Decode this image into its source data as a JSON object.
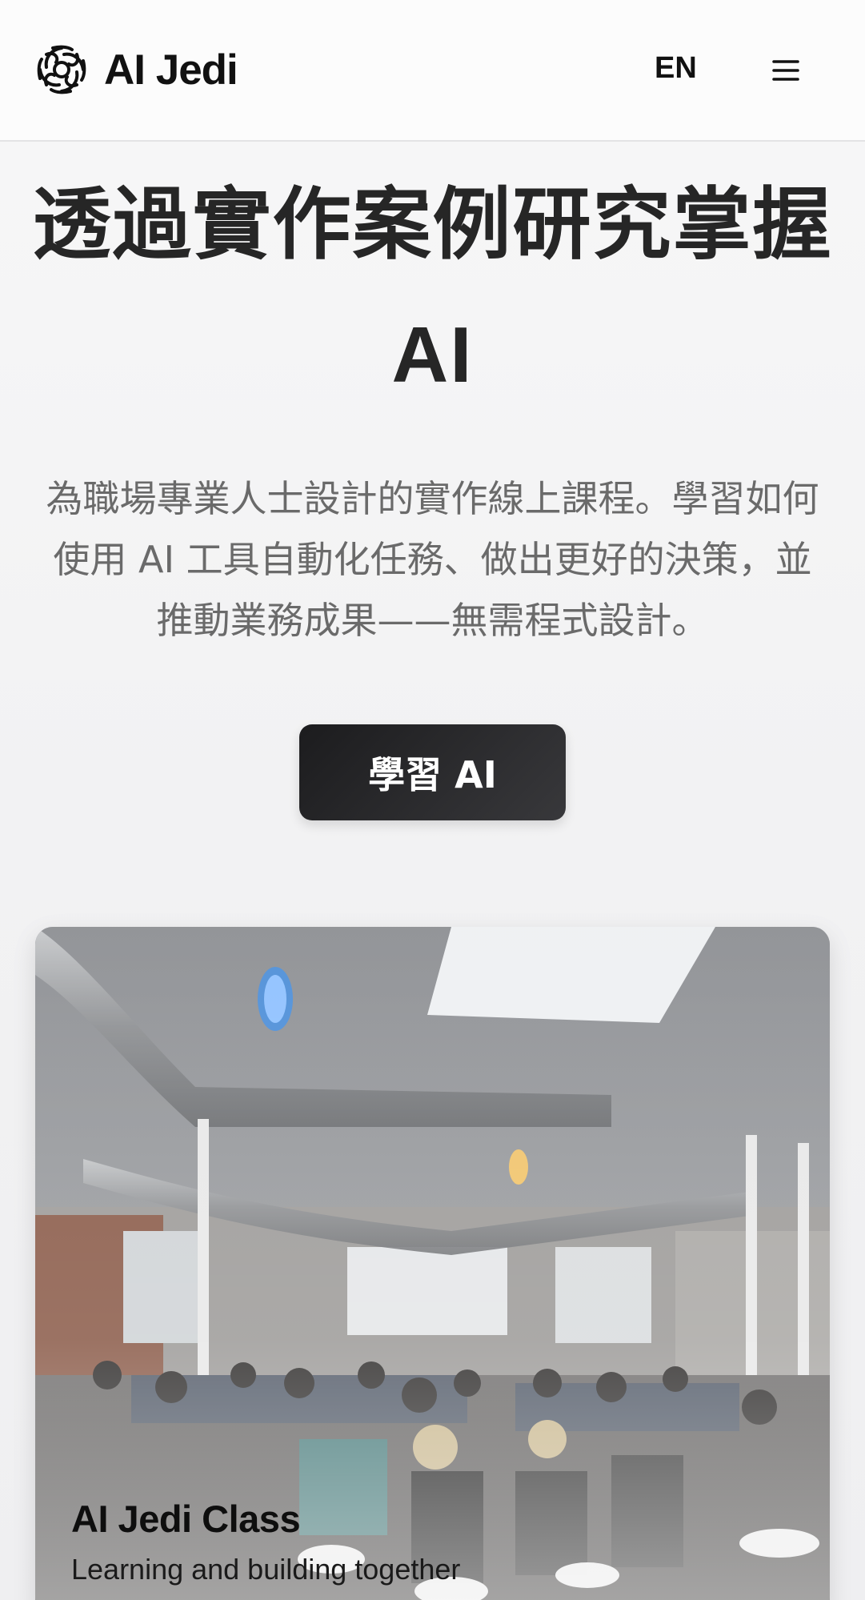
{
  "header": {
    "brand": "AI Jedi",
    "lang_label": "EN",
    "logo_icon": "brain-swirl-icon",
    "menu_icon": "hamburger-menu-icon"
  },
  "hero": {
    "title_line1": "透過實作案例研究掌握",
    "title_line2": "AI",
    "description": "為職場專業人士設計的實作線上課程。學習如何使用 AI 工具自動化任務、做出更好的決策，並推動業務成果——無需程式設計。",
    "cta_label": "學習 AI"
  },
  "card": {
    "title": "AI Jedi Class",
    "subtitle": "Learning and building together"
  },
  "colors": {
    "primary_button": "#1f1f21",
    "title_text": "#262626",
    "body_text": "#6a6a6a"
  }
}
